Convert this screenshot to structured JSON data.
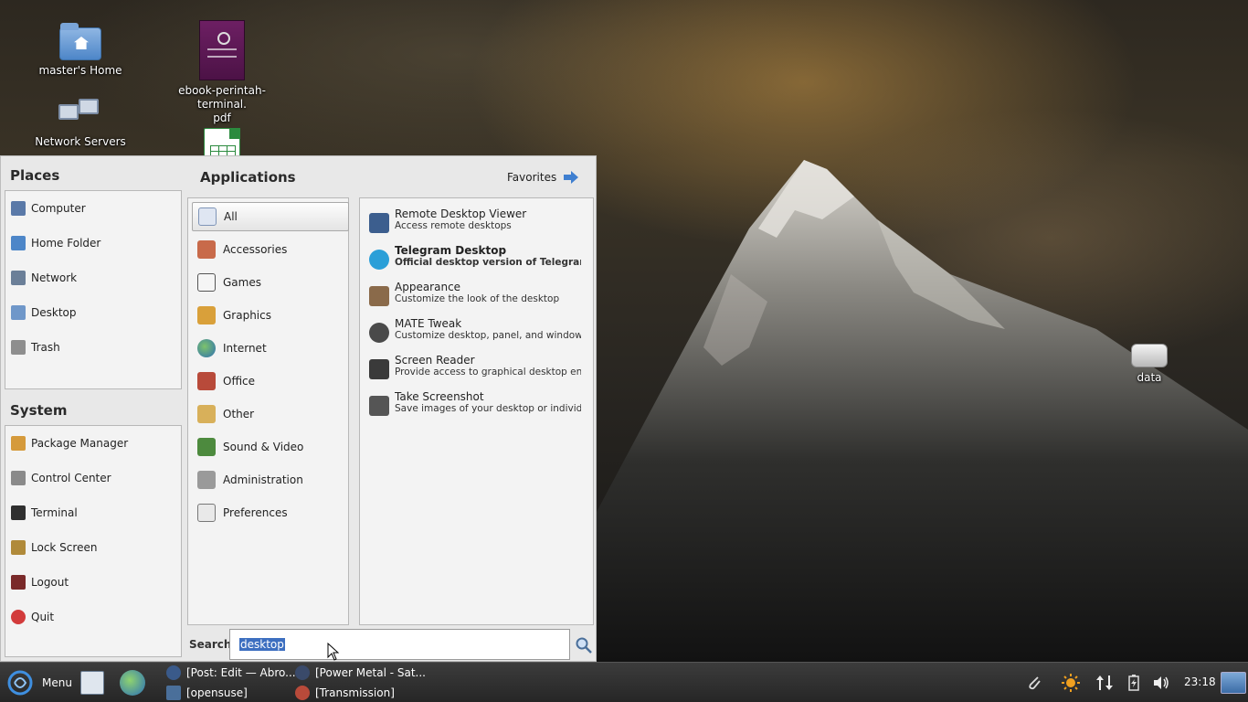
{
  "desktop": {
    "icons": [
      {
        "label": "master's Home",
        "icon": "home-folder-icon"
      },
      {
        "label": "ebook-perintah-terminal.\npdf",
        "icon": "pdf-book-icon"
      },
      {
        "label": "Network Servers",
        "icon": "network-icon"
      },
      {
        "label": "data",
        "icon": "drive-icon"
      }
    ]
  },
  "menu": {
    "places_title": "Places",
    "places": [
      {
        "label": "Computer",
        "icon": "computer-icon"
      },
      {
        "label": "Home Folder",
        "icon": "home-icon"
      },
      {
        "label": "Network",
        "icon": "network-icon"
      },
      {
        "label": "Desktop",
        "icon": "desktop-icon"
      },
      {
        "label": "Trash",
        "icon": "trash-icon"
      }
    ],
    "system_title": "System",
    "system": [
      {
        "label": "Package Manager",
        "icon": "package-icon"
      },
      {
        "label": "Control Center",
        "icon": "control-center-icon"
      },
      {
        "label": "Terminal",
        "icon": "terminal-icon"
      },
      {
        "label": "Lock Screen",
        "icon": "lock-icon"
      },
      {
        "label": "Logout",
        "icon": "logout-icon"
      },
      {
        "label": "Quit",
        "icon": "power-icon"
      }
    ],
    "applications_title": "Applications",
    "favorites_label": "Favorites",
    "categories": [
      {
        "label": "All",
        "selected": true
      },
      {
        "label": "Accessories"
      },
      {
        "label": "Games"
      },
      {
        "label": "Graphics"
      },
      {
        "label": "Internet"
      },
      {
        "label": "Office"
      },
      {
        "label": "Other"
      },
      {
        "label": "Sound & Video"
      },
      {
        "label": "Administration"
      },
      {
        "label": "Preferences"
      }
    ],
    "apps": [
      {
        "name": "Remote Desktop Viewer",
        "desc": "Access remote desktops",
        "icon": "remote-desktop-icon"
      },
      {
        "name": "Telegram Desktop",
        "desc": "Official desktop version of Telegram messa...",
        "icon": "telegram-icon",
        "bold": true
      },
      {
        "name": "Appearance",
        "desc": "Customize the look of the desktop",
        "icon": "appearance-icon"
      },
      {
        "name": "MATE Tweak",
        "desc": "Customize desktop, panel, and window man...",
        "icon": "tweak-icon"
      },
      {
        "name": "Screen Reader",
        "desc": "Provide access to graphical desktop environ...",
        "icon": "screen-reader-icon"
      },
      {
        "name": "Take Screenshot",
        "desc": "Save images of your desktop or individual wi...",
        "icon": "camera-icon"
      }
    ],
    "search": {
      "label": "Search:",
      "value": "desktop"
    }
  },
  "taskbar": {
    "menu_label": "Menu",
    "tasks": [
      {
        "label": "[Post: Edit — Abro...",
        "icon": "browser-icon"
      },
      {
        "label": "[opensuse]",
        "icon": "folder-icon"
      },
      {
        "label": "[Power Metal - Sat...",
        "icon": "music-icon"
      },
      {
        "label": "[Transmission]",
        "icon": "transmission-icon"
      }
    ],
    "clock": "23:18"
  }
}
